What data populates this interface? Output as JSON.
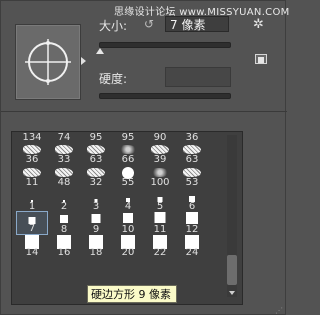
{
  "watermark": "思缘设计论坛 www.MISSYUAN.COM",
  "size": {
    "label": "大小:",
    "value": "7 像素",
    "slider_fraction": 0.0
  },
  "hardness": {
    "label": "硬度:"
  },
  "icons": {
    "reset": "↺",
    "gear": "✲",
    "new_preset": "new-preset-icon"
  },
  "grid": {
    "rows": [
      {
        "kind": "scatter",
        "numbers": [
          "134",
          "74",
          "95",
          "95",
          "90",
          "36"
        ]
      },
      {
        "kind": "scatter",
        "numbers": [
          "36",
          "33",
          "63",
          "66",
          "39",
          "63"
        ]
      },
      {
        "kind": "scatter",
        "numbers": [
          "11",
          "48",
          "32",
          "55",
          "100",
          "53"
        ]
      },
      {
        "kind": "square",
        "numbers": [
          "1",
          "2",
          "3",
          "4",
          "5",
          "6"
        ]
      },
      {
        "kind": "square",
        "numbers": [
          "7",
          "8",
          "9",
          "10",
          "11",
          "12"
        ]
      },
      {
        "kind": "square",
        "numbers": [
          "14",
          "16",
          "18",
          "20",
          "22",
          "24"
        ]
      }
    ],
    "selected": "7"
  },
  "tooltip": "硬边方形 9 像素"
}
